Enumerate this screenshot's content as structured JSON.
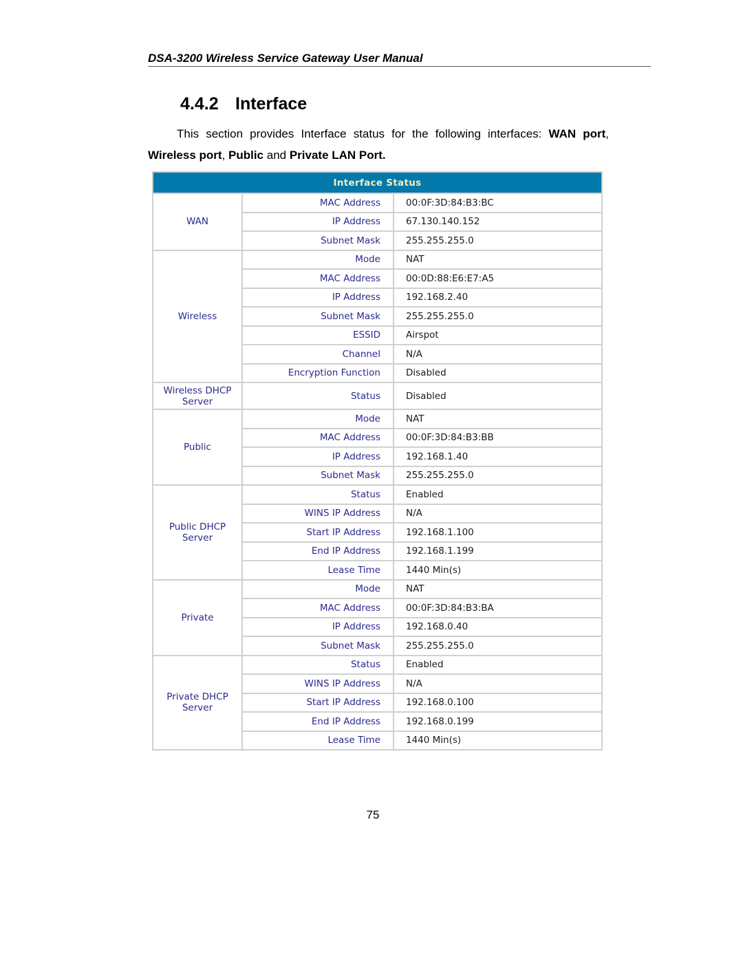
{
  "header": {
    "title": "DSA-3200 Wireless Service Gateway User Manual"
  },
  "section": {
    "number": "4.4.2",
    "title": "Interface"
  },
  "intro": {
    "t1": "This section provides Interface status for the following interfaces: ",
    "b1": "WAN port",
    "t2": ",",
    "b2": "Wireless port",
    "t3": ", ",
    "b3": "Public",
    "t4": " and ",
    "b4": "Private LAN Port."
  },
  "table": {
    "title": "Interface Status",
    "colors": {
      "header_bg": "#0378ab",
      "header_text": "#f4f0b8",
      "label_text": "#2a2a8c",
      "border": "#d0d0d0"
    },
    "groups": [
      {
        "name": "WAN",
        "rows": [
          {
            "label": "MAC Address",
            "value": "00:0F:3D:84:B3:BC"
          },
          {
            "label": "IP Address",
            "value": "67.130.140.152"
          },
          {
            "label": "Subnet Mask",
            "value": "255.255.255.0"
          }
        ]
      },
      {
        "name": "Wireless",
        "rows": [
          {
            "label": "Mode",
            "value": "NAT"
          },
          {
            "label": "MAC Address",
            "value": "00:0D:88:E6:E7:A5"
          },
          {
            "label": "IP Address",
            "value": "192.168.2.40"
          },
          {
            "label": "Subnet Mask",
            "value": "255.255.255.0"
          },
          {
            "label": "ESSID",
            "value": "Airspot"
          },
          {
            "label": "Channel",
            "value": "N/A"
          },
          {
            "label": "Encryption Function",
            "value": "Disabled"
          }
        ]
      },
      {
        "name_line1": "Wireless DHCP",
        "name_line2": "Server",
        "rows": [
          {
            "label": "Status",
            "value": "Disabled"
          }
        ]
      },
      {
        "name": "Public",
        "rows": [
          {
            "label": "Mode",
            "value": "NAT"
          },
          {
            "label": "MAC Address",
            "value": "00:0F:3D:84:B3:BB"
          },
          {
            "label": "IP Address",
            "value": "192.168.1.40"
          },
          {
            "label": "Subnet Mask",
            "value": "255.255.255.0"
          }
        ]
      },
      {
        "name_line1": "Public DHCP",
        "name_line2": "Server",
        "rows": [
          {
            "label": "Status",
            "value": "Enabled"
          },
          {
            "label": "WINS IP Address",
            "value": "N/A"
          },
          {
            "label": "Start IP Address",
            "value": "192.168.1.100"
          },
          {
            "label": "End IP Address",
            "value": "192.168.1.199"
          },
          {
            "label": "Lease Time",
            "value": "1440 Min(s)"
          }
        ]
      },
      {
        "name": "Private",
        "rows": [
          {
            "label": "Mode",
            "value": "NAT"
          },
          {
            "label": "MAC Address",
            "value": "00:0F:3D:84:B3:BA"
          },
          {
            "label": "IP Address",
            "value": "192.168.0.40"
          },
          {
            "label": "Subnet Mask",
            "value": "255.255.255.0"
          }
        ]
      },
      {
        "name_line1": "Private DHCP",
        "name_line2": "Server",
        "rows": [
          {
            "label": "Status",
            "value": "Enabled"
          },
          {
            "label": "WINS IP Address",
            "value": "N/A"
          },
          {
            "label": "Start IP Address",
            "value": "192.168.0.100"
          },
          {
            "label": "End IP Address",
            "value": "192.168.0.199"
          },
          {
            "label": "Lease Time",
            "value": "1440 Min(s)"
          }
        ]
      }
    ]
  },
  "footer": {
    "page_number": "75"
  }
}
